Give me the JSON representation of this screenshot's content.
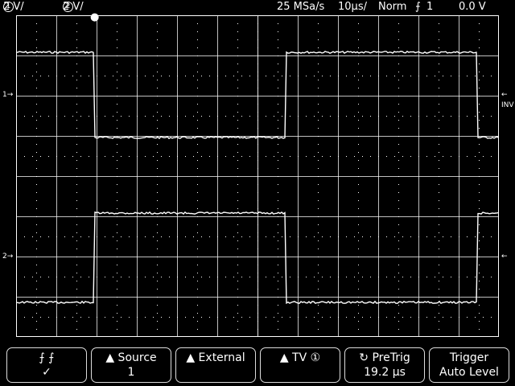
{
  "status": {
    "ch1_num": "1",
    "ch1_scale": "2 V/",
    "ch2_num": "2",
    "ch2_scale": "2 V/",
    "sample_rate": "25 MSa/s",
    "timebase": "10µs/",
    "mode": "Norm",
    "trigger_source": "1",
    "trigger_level": "0.0 V"
  },
  "markers": {
    "ch1_ground": "1",
    "ch2_ground": "2",
    "inv_label": "INV",
    "trigger_marker": "T"
  },
  "softkeys": [
    {
      "line1": "⨍   ⨍",
      "line2": "✓"
    },
    {
      "line1": "▲ Source",
      "line2": "1"
    },
    {
      "line1": "▲ External",
      "line2": ""
    },
    {
      "line1": "▲ TV ①",
      "line2": ""
    },
    {
      "line1": "↻ PreTrig",
      "line2": "19.2 µs"
    },
    {
      "line1": "Trigger",
      "line2": "Auto Level"
    }
  ],
  "colors": {
    "background": "#000000",
    "foreground": "#ffffff",
    "grid": "#ffffff"
  }
}
